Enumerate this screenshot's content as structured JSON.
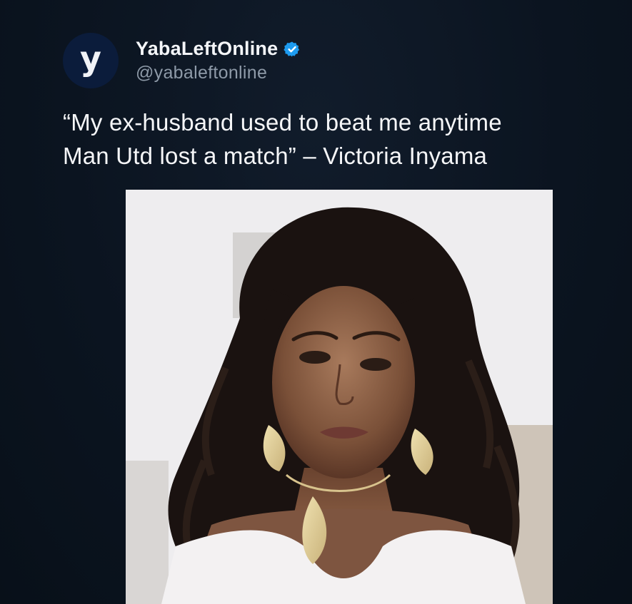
{
  "post": {
    "avatar_letter": "y",
    "display_name": "YabaLeftOnline",
    "handle": "@yabaleftonline",
    "verified_icon": "verified-badge-icon",
    "text_lines": [
      "“My ex-husband used to beat me anytime",
      "Man Utd lost a match” – Victoria Inyama"
    ],
    "media_subject": "portrait-photo"
  },
  "colors": {
    "background": "#0c1522",
    "avatar_bg": "#0b1c3b",
    "verified": "#1d9bf0",
    "handle": "#8e9aa8"
  }
}
